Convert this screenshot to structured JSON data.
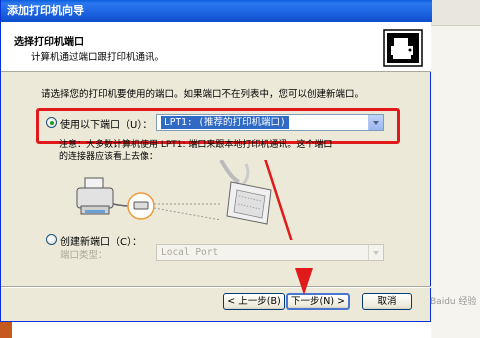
{
  "window": {
    "title": "添加打印机向导",
    "header_title": "选择打印机端口",
    "header_subtitle": "计算机通过端口跟打印机通讯。",
    "header_icon": "printer-port-icon"
  },
  "content": {
    "intro": "请选择您的打印机要使用的端口。如果端口不在列表中，您可以创建新端口。",
    "use_port": {
      "label": "使用以下端口（U）：",
      "selected": true,
      "value": "LPT1: (推荐的打印机端口)"
    },
    "note_line1": "注意：大多数计算机使用 LPT1: 端口来跟本地打印机通讯。这个端口",
    "note_line2": "的连接器应该看上去像：",
    "create_port": {
      "label": "创建新端口（C）：",
      "selected": false,
      "type_label": "端口类型：",
      "type_value": "Local Port"
    }
  },
  "buttons": {
    "back": "< 上一步(B)",
    "next": "下一步(N) >",
    "cancel": "取消"
  },
  "watermark": "Baidu 经验",
  "colors": {
    "titlebar": "#0a5ddb",
    "highlight_box": "#e0191a",
    "selection": "#316ac5",
    "radio_dot": "#21a121"
  }
}
